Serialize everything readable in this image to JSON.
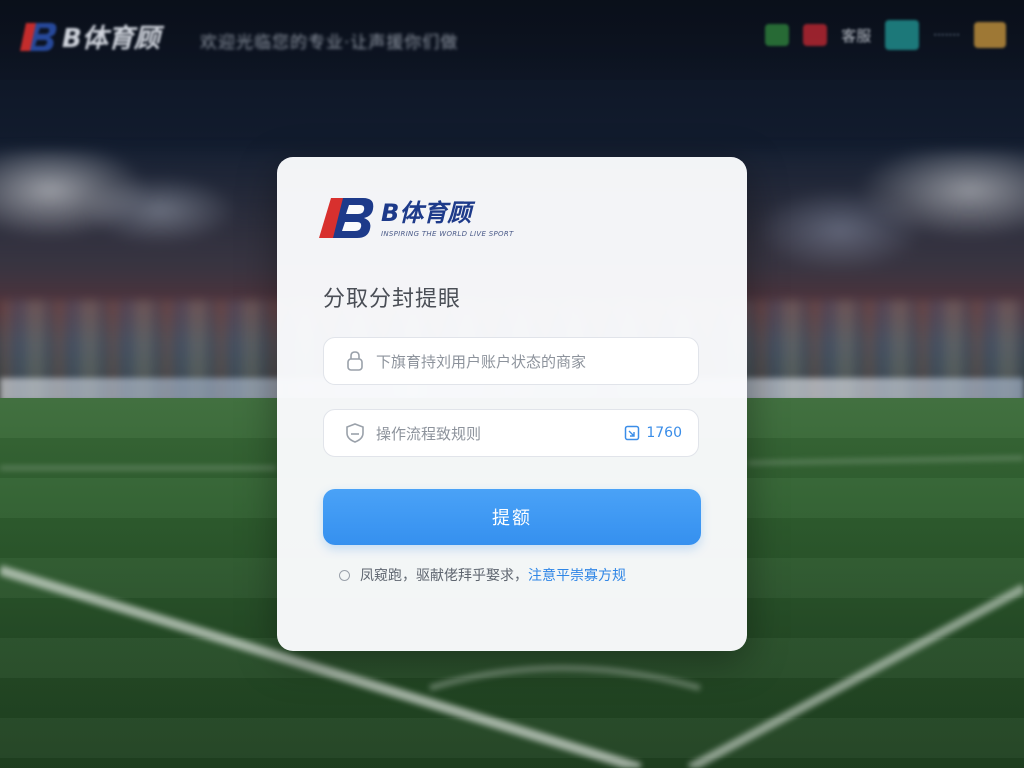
{
  "topbar": {
    "brand": "B体育顾",
    "slogan": "欢迎光临您的专业·让声援你们做",
    "right_text": "客服",
    "right_text2": "·······"
  },
  "card": {
    "logo_name": "B体育顾",
    "logo_sub": "INSPIRING THE WORLD LIVE SPORT",
    "title": "分取分封提眼",
    "account_placeholder": "下旗育持刘用户账户状态的商家",
    "code_placeholder": "操作流程致规则",
    "code_side": "1760",
    "submit_label": "提额",
    "notice_prefix": "凤窥跑，驱献佬拜乎娶求，",
    "notice_link": "注意平崇寡方规"
  },
  "colors": {
    "accent": "#3590ef",
    "brand_blue": "#1d3a8a",
    "brand_red": "#d8302e"
  },
  "icons": {
    "account": "user-lock-icon",
    "code": "shield-icon",
    "side": "refresh-code-icon"
  }
}
